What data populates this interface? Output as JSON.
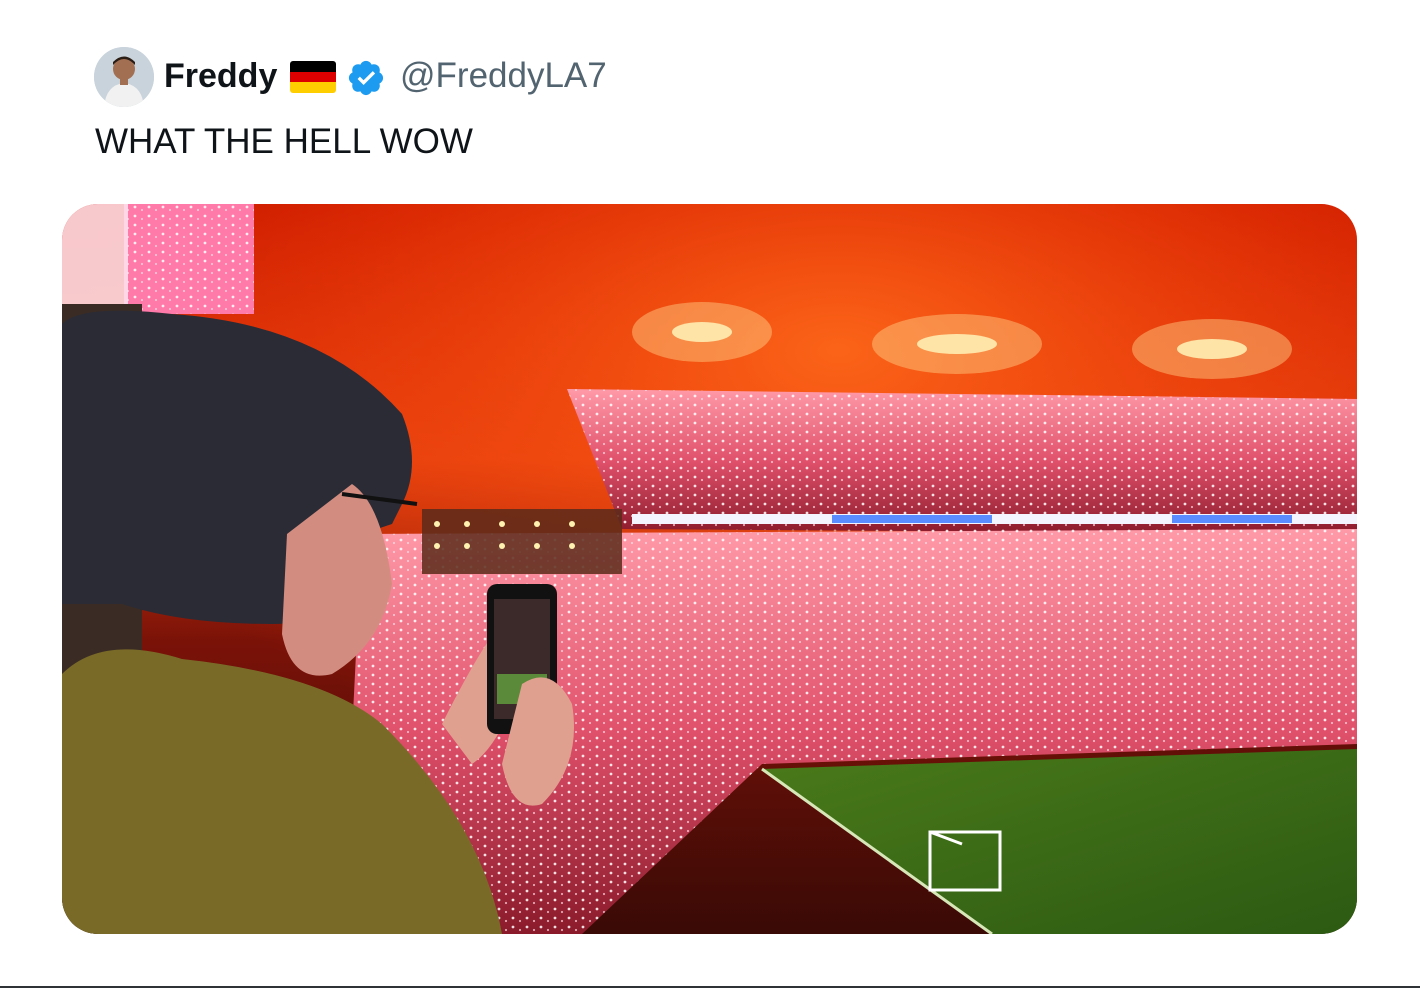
{
  "tweet": {
    "author": {
      "display_name": "Freddy",
      "handle": "@FreddyLA7",
      "flag_icon": "germany-flag-icon",
      "verified_icon": "verified-badge-icon",
      "verified_color": "#1d9bf0"
    },
    "text": "WHAT THE HELL WOW",
    "media": {
      "type": "video",
      "icon": "stadium-video-thumbnail"
    }
  },
  "colors": {
    "text_primary": "#0f1419",
    "text_secondary": "#536471",
    "flag_black": "#000000",
    "flag_red": "#dd0000",
    "flag_gold": "#ffce00"
  }
}
